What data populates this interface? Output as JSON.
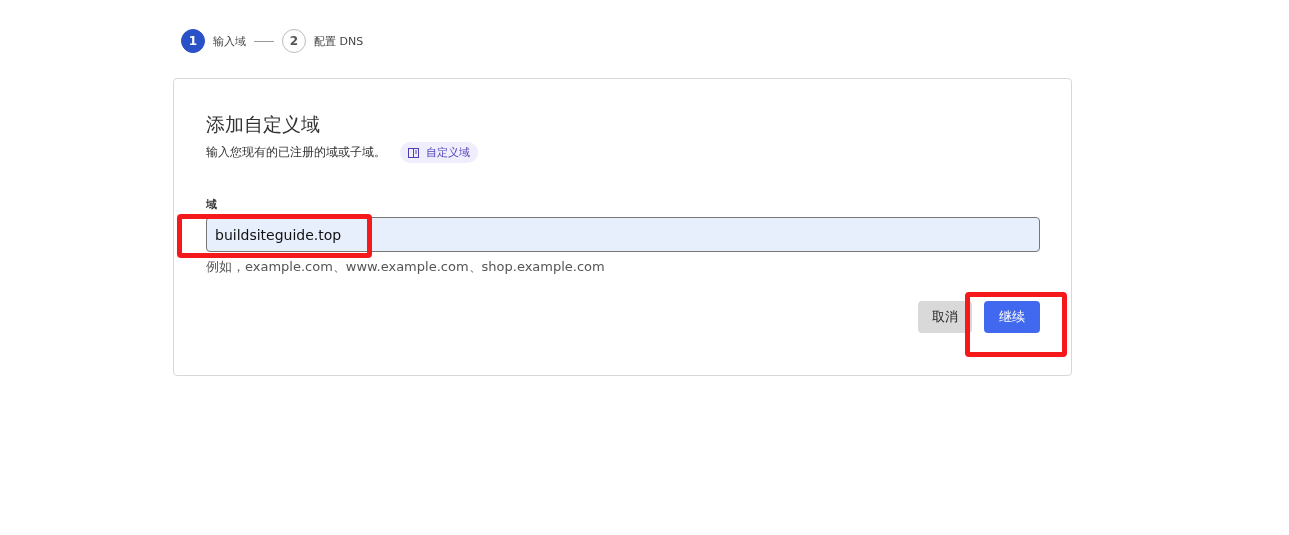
{
  "steps": [
    {
      "number": "1",
      "label": "输入域",
      "selected": true
    },
    {
      "number": "2",
      "label": "配置 DNS",
      "selected": false
    }
  ],
  "card": {
    "title": "添加自定义域",
    "subtitle": "输入您现有的已注册的域或子域。",
    "doc_link": "自定义域",
    "field": {
      "label": "域",
      "value": "buildsiteguide.top",
      "hint": "例如，example.com、www.example.com、shop.example.com"
    },
    "buttons": [
      {
        "label": "取消",
        "kind": "secondary"
      },
      {
        "label": "继续",
        "kind": "primary"
      }
    ]
  }
}
